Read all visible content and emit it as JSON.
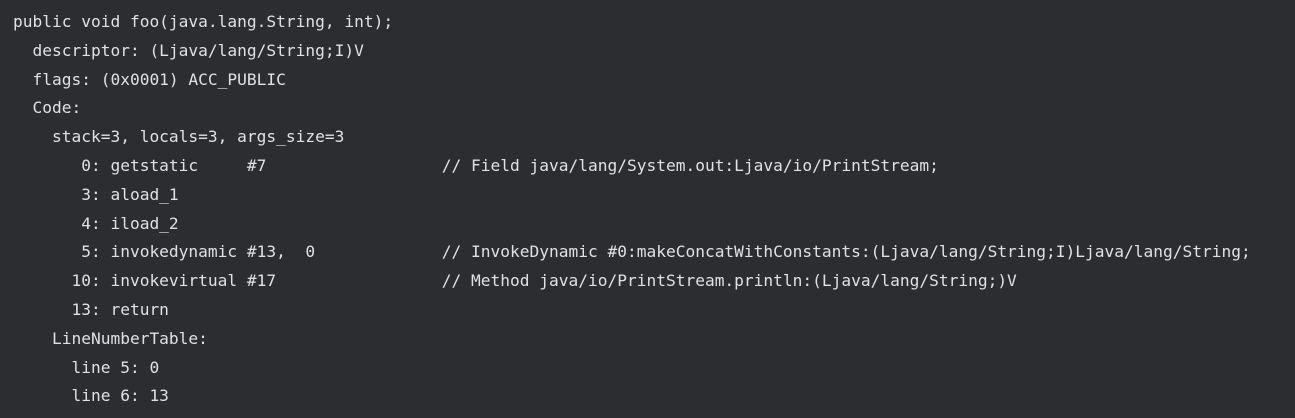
{
  "code_block": {
    "lines": [
      "public void foo(java.lang.String, int);",
      "  descriptor: (Ljava/lang/String;I)V",
      "  flags: (0x0001) ACC_PUBLIC",
      "  Code:",
      "    stack=3, locals=3, args_size=3",
      "       0: getstatic     #7                  // Field java/lang/System.out:Ljava/io/PrintStream;",
      "       3: aload_1",
      "       4: iload_2",
      "       5: invokedynamic #13,  0             // InvokeDynamic #0:makeConcatWithConstants:(Ljava/lang/String;I)Ljava/lang/String;",
      "      10: invokevirtual #17                 // Method java/io/PrintStream.println:(Ljava/lang/String;)V",
      "      13: return",
      "    LineNumberTable:",
      "      line 5: 0",
      "      line 6: 13"
    ]
  }
}
